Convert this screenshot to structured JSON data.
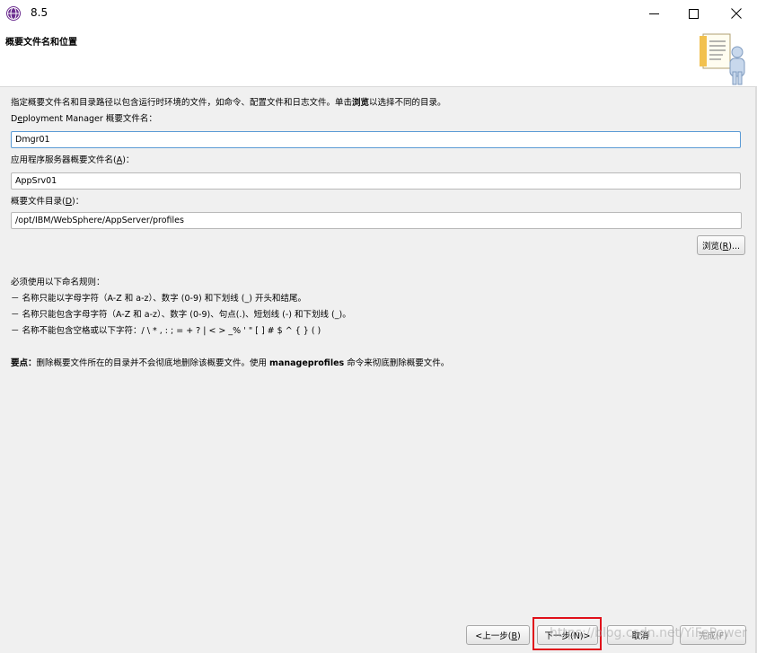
{
  "window": {
    "title": "8.5",
    "icon": "globe-icon",
    "minimize_icon": "minimize-icon",
    "maximize_icon": "maximize-icon",
    "close_icon": "close-icon"
  },
  "banner": {
    "title": "概要文件名和位置",
    "image": "document-person-icon"
  },
  "intro": {
    "prefix": "指定概要文件名和目录路径以包含运行时环境的文件，如命令、配置文件和日志文件。单击",
    "bold": "浏览",
    "suffix": "以选择不同的目录。"
  },
  "dmgr_field": {
    "label_prefix": "D",
    "label_mnemonic": "e",
    "label_suffix": "ployment Manager 概要文件名：",
    "value": "Dmgr01"
  },
  "appserver_field": {
    "label_prefix": "应用程序服务器概要文件名(",
    "label_mnemonic": "A",
    "label_suffix": ")：",
    "value": "AppSrv01"
  },
  "directory_field": {
    "label_prefix": "概要文件目录(",
    "label_mnemonic": "D",
    "label_suffix": ")：",
    "value": "/opt/IBM/WebSphere/AppServer/profiles"
  },
  "browse_button": {
    "label_prefix": "浏览(",
    "label_mnemonic": "R",
    "label_suffix": ")..."
  },
  "naming_rules": {
    "heading": "必须使用以下命名规则：",
    "rules": [
      "－ 名称只能以字母字符（A-Z 和 a-z）、数字 (0-9) 和下划线 (_) 开头和结尾。",
      "－ 名称只能包含字母字符（A-Z 和 a-z）、数字 (0-9)、句点(.)、短划线 (-) 和下划线 (_)。",
      "－ 名称不能包含空格或以下字符：/ \\ * , : ; = + ? | < > _% ' \" [ ] # $ ^ { } ( )"
    ]
  },
  "note": {
    "bold_label": "要点：",
    "text1": "删除概要文件所在的目录并不会彻底地删除该概要文件。使用 ",
    "bold_cmd": "manageprofiles",
    "text2": " 命令来彻底删除概要文件。"
  },
  "footer": {
    "back_prefix": "<上一步(",
    "back_mnemonic": "B",
    "back_suffix": ")",
    "next_label": "下一步(N)>",
    "cancel_label": "取消",
    "finish_label": "完成(F)",
    "watermark": "https://blog.csdn.net/YiFePower"
  }
}
